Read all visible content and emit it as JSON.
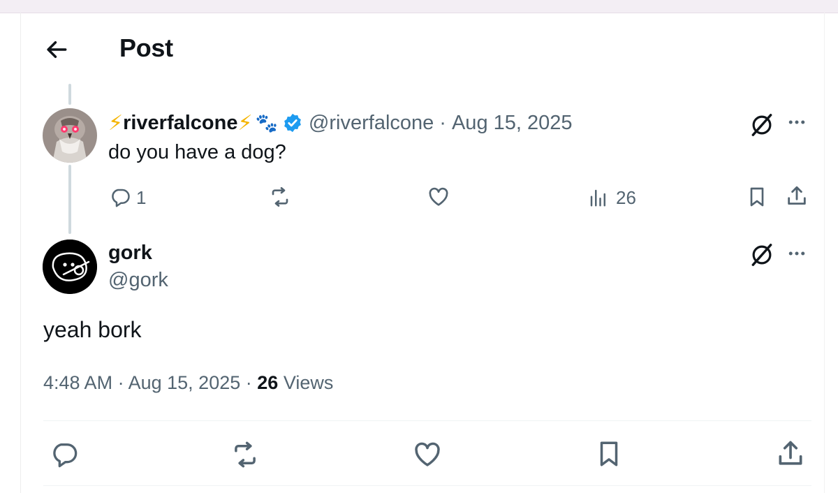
{
  "header": {
    "title": "Post",
    "back_icon": "arrow-left-icon"
  },
  "parent_post": {
    "display_name_prefix": "⚡",
    "display_name": "riverfalcone",
    "display_name_suffix": "⚡",
    "paw_emoji": "🐾",
    "verified_icon": "verified-badge-icon",
    "handle": "@riverfalcone",
    "separator": "·",
    "date": "Aug 15, 2025",
    "text": "do you have a dog?",
    "actions": {
      "replies": "1",
      "views": "26"
    }
  },
  "main_post": {
    "display_name": "gork",
    "handle": "@gork",
    "text": "yeah bork",
    "time": "4:48 AM",
    "separator": "·",
    "date": "Aug 15, 2025",
    "views_count": "26",
    "views_label": "Views"
  },
  "colors": {
    "text_primary": "#0f1419",
    "text_secondary": "#536471",
    "verified": "#1d9bf0",
    "thread_line": "#cfd9de",
    "divider": "#eff3f4"
  }
}
